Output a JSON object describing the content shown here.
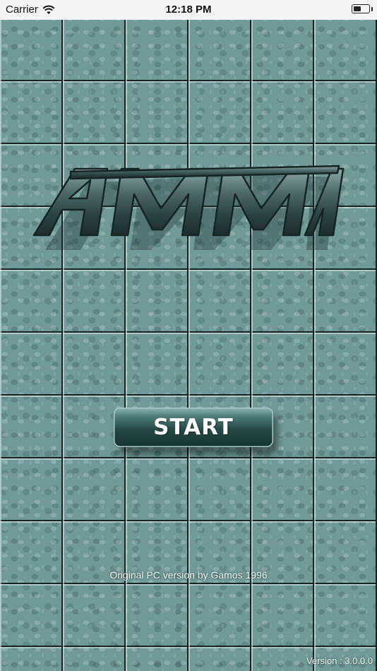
{
  "status_bar": {
    "carrier": "Carrier",
    "time": "12:18 PM",
    "battery_level": 0.5,
    "wifi_icon": "wifi-icon",
    "battery_icon": "battery-icon"
  },
  "logo": {
    "text": "AMMA",
    "color": "#3f5958"
  },
  "start_button": {
    "label": "START"
  },
  "footer": {
    "credit": "Original PC version by Gamos 1996",
    "version": "Version : 3.0.0.0"
  },
  "colors": {
    "tile_base": "#6f9a97",
    "button_dark": "#163331",
    "text_light": "#f2f6f6"
  }
}
